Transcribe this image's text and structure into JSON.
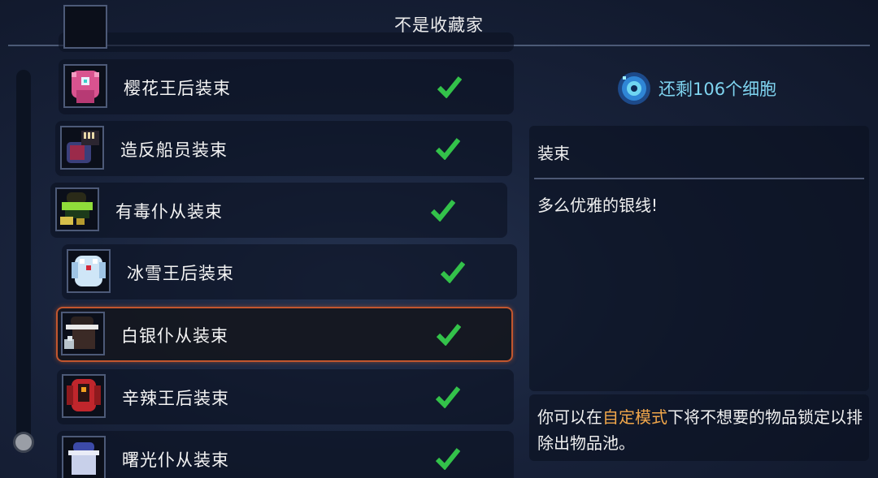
{
  "title": "不是收藏家",
  "outfits": [
    {
      "label": "樱花王后装束",
      "icon": "sakura-queen-outfit-icon",
      "unlocked": true
    },
    {
      "label": "造反船员装束",
      "icon": "mutineer-outfit-icon",
      "unlocked": true
    },
    {
      "label": "有毒仆从装束",
      "icon": "toxic-servant-outfit-icon",
      "unlocked": true
    },
    {
      "label": "冰雪王后装束",
      "icon": "ice-queen-outfit-icon",
      "unlocked": true
    },
    {
      "label": "白银仆从装束",
      "icon": "silver-servant-outfit-icon",
      "unlocked": true,
      "selected": true
    },
    {
      "label": "辛辣王后装束",
      "icon": "spicy-queen-outfit-icon",
      "unlocked": true
    },
    {
      "label": "曙光仆从装束",
      "icon": "dawn-servant-outfit-icon",
      "unlocked": true
    }
  ],
  "cells": {
    "text": "还剩106个细胞",
    "icon": "cell-icon"
  },
  "detail": {
    "category": "装束",
    "description": "多么优雅的银线!"
  },
  "hint": {
    "before": "你可以在",
    "highlight": "自定模式",
    "after": "下将不想要的物品锁定以排除出物品池。"
  },
  "colors": {
    "accent_highlight": "#f0a64a",
    "cells_text": "#7fd4f0",
    "selected_border": "#c2562e",
    "check": "#33c24a"
  }
}
